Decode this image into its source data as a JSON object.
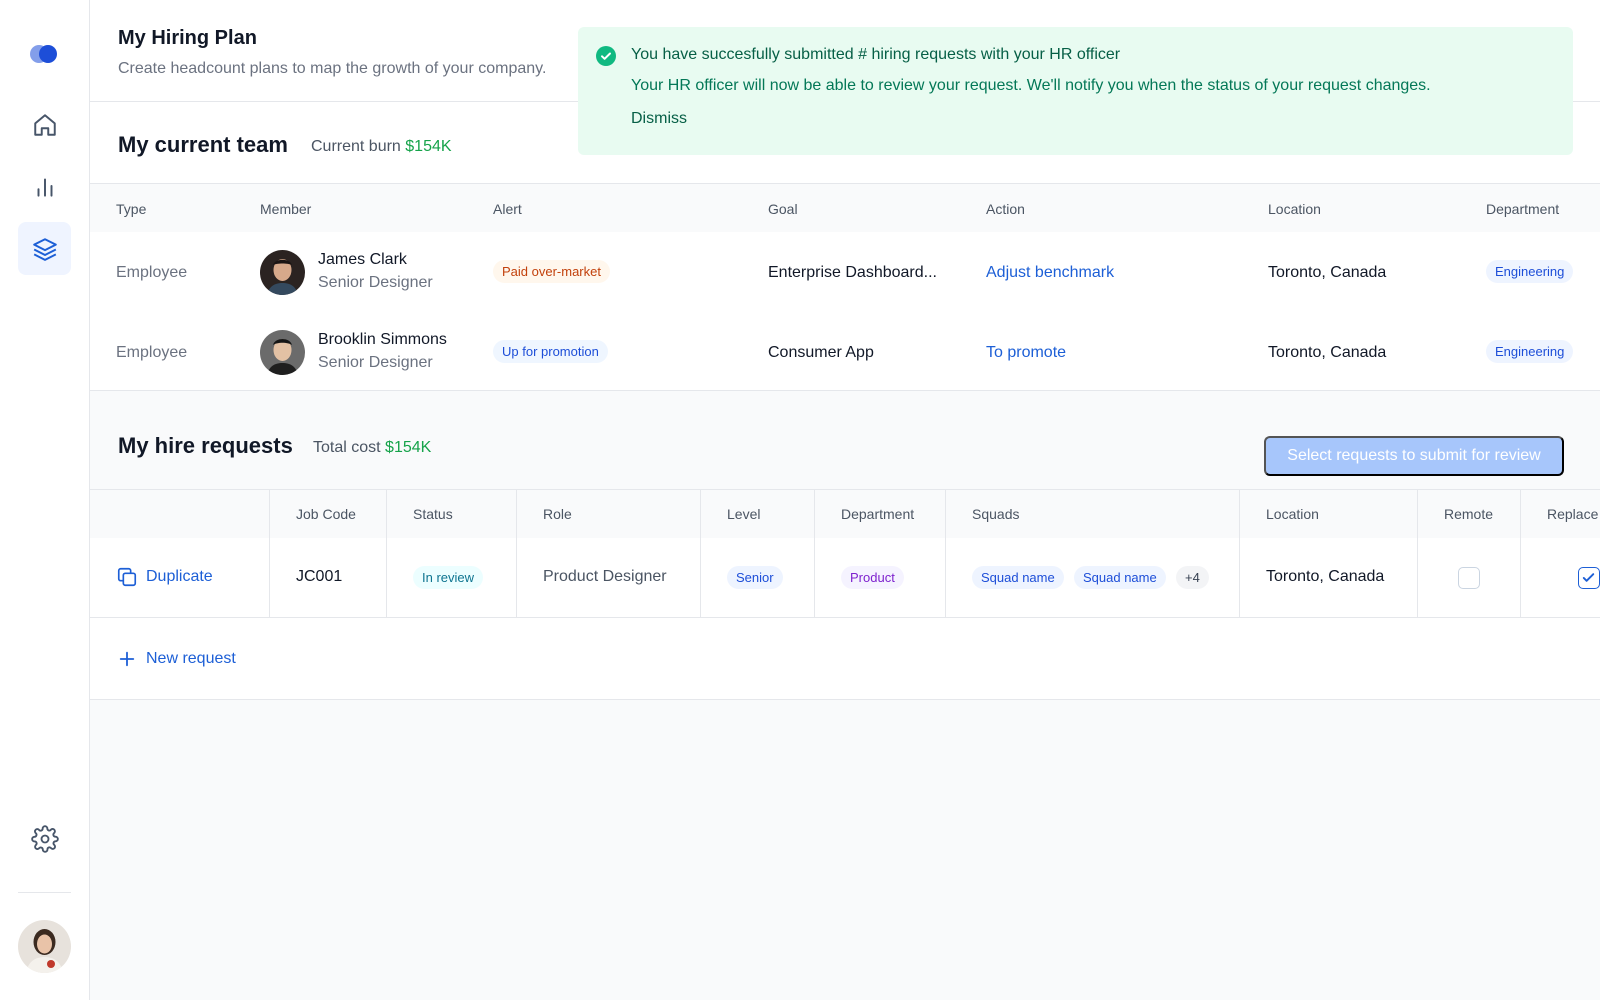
{
  "header": {
    "title": "My Hiring Plan",
    "subtitle": "Create headcount plans to map the growth of your company."
  },
  "toast": {
    "title": "You have succesfully submitted # hiring requests with your HR officer",
    "body": "Your HR officer will now be able to review your request. We'll notify you when the status of your request changes.",
    "dismiss": "Dismiss"
  },
  "team": {
    "title": "My current team",
    "burn_label": "Current burn",
    "burn_value": "$154K",
    "columns": [
      "Type",
      "Member",
      "Alert",
      "Goal",
      "Action",
      "Location",
      "Department"
    ],
    "rows": [
      {
        "type": "Employee",
        "name": "James Clark",
        "role": "Senior Designer",
        "alert": "Paid over-market",
        "goal": "Enterprise Dashboard...",
        "action": "Adjust benchmark",
        "location": "Toronto, Canada",
        "department": "Engineering"
      },
      {
        "type": "Employee",
        "name": "Brooklin Simmons",
        "role": "Senior Designer",
        "alert": "Up for promotion",
        "goal": "Consumer App",
        "action": "To promote",
        "location": "Toronto, Canada",
        "department": "Engineering"
      }
    ]
  },
  "hire": {
    "title": "My hire requests",
    "cost_label": "Total cost",
    "cost_value": "$154K",
    "submit": "Select requests to submit for review",
    "columns": [
      "Job Code",
      "Status",
      "Role",
      "Level",
      "Department",
      "Squads",
      "Location",
      "Remote",
      "Replace"
    ],
    "row": {
      "action": "Duplicate",
      "job_code": "JC001",
      "status": "In review",
      "role": "Product Designer",
      "level": "Senior",
      "department": "Product",
      "squads": [
        "Squad name",
        "Squad name"
      ],
      "squads_more": "+4",
      "location": "Toronto, Canada",
      "remote": false,
      "replace": true
    },
    "new_request": "New request"
  },
  "icons": {
    "logo": "logo-icon",
    "home": "home-icon",
    "chart": "bar-chart-icon",
    "layers": "layers-icon",
    "settings": "gear-icon"
  },
  "colors": {
    "accent": "#1d5fd6",
    "success": "#16a34a",
    "toast_bg": "#e8fbf1"
  }
}
